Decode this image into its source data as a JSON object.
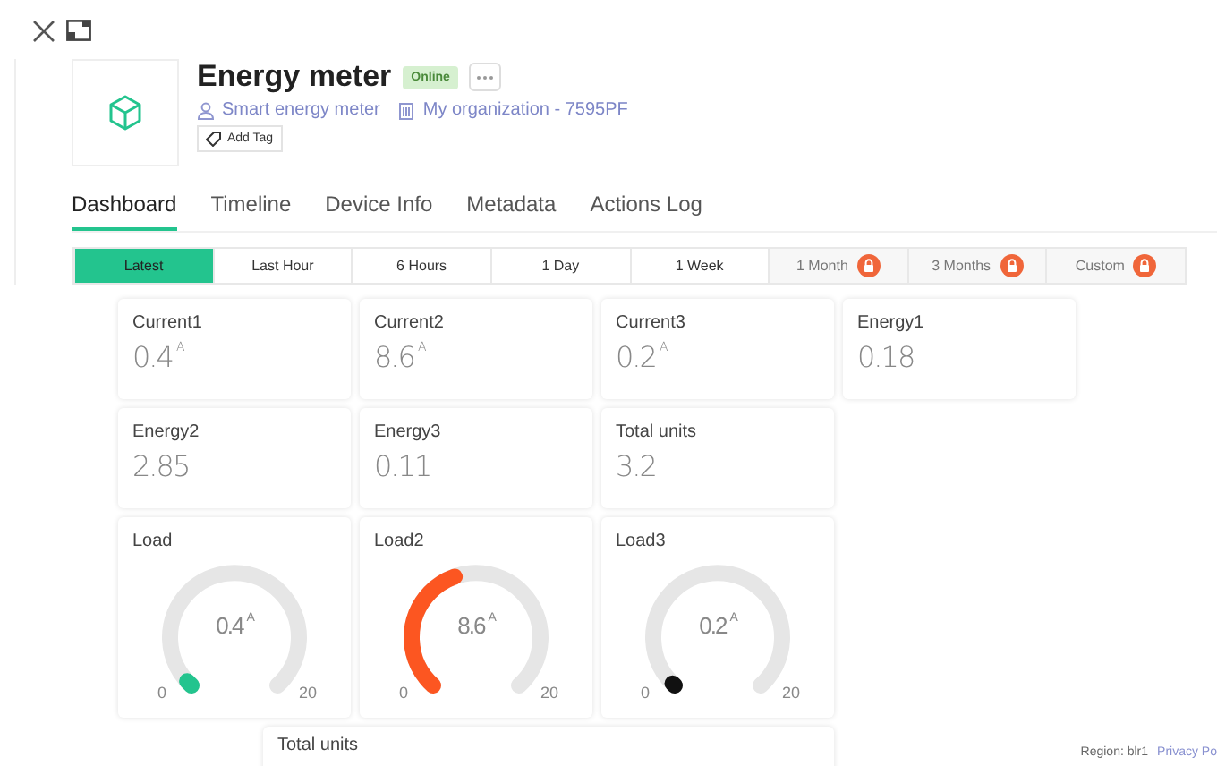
{
  "device": {
    "name": "Energy meter",
    "status": "Online",
    "template": "Smart energy meter",
    "organization": "My organization - 7595PF",
    "add_tag": "Add Tag"
  },
  "tabs": [
    {
      "label": "Dashboard",
      "selected": true
    },
    {
      "label": "Timeline",
      "selected": false
    },
    {
      "label": "Device Info",
      "selected": false
    },
    {
      "label": "Metadata",
      "selected": false
    },
    {
      "label": "Actions Log",
      "selected": false
    }
  ],
  "ranges": [
    {
      "label": "Latest",
      "selected": true,
      "locked": false
    },
    {
      "label": "Last Hour",
      "selected": false,
      "locked": false
    },
    {
      "label": "6 Hours",
      "selected": false,
      "locked": false
    },
    {
      "label": "1 Day",
      "selected": false,
      "locked": false
    },
    {
      "label": "1 Week",
      "selected": false,
      "locked": false
    },
    {
      "label": "1 Month",
      "selected": false,
      "locked": true
    },
    {
      "label": "3 Months",
      "selected": false,
      "locked": true
    },
    {
      "label": "Custom",
      "selected": false,
      "locked": true
    }
  ],
  "widgets": [
    {
      "kind": "value",
      "label": "Current1",
      "value": "0.4",
      "unit": "A"
    },
    {
      "kind": "value",
      "label": "Current2",
      "value": "8.6",
      "unit": "A"
    },
    {
      "kind": "value",
      "label": "Current3",
      "value": "0.2",
      "unit": "A"
    },
    {
      "kind": "value",
      "label": "Energy1",
      "value": "0.18"
    },
    {
      "kind": "value",
      "label": "Energy2",
      "value": "2.85"
    },
    {
      "kind": "value",
      "label": "Energy3",
      "value": "0.11"
    },
    {
      "kind": "value",
      "label": "Total units",
      "value": "3.2"
    },
    {
      "kind": "gauge",
      "label": "Load",
      "value": "0.4",
      "unit": "A",
      "color": "#23c48e",
      "min": "0",
      "max": "20"
    },
    {
      "kind": "gauge",
      "label": "Load2",
      "value": "8.6",
      "unit": "A",
      "color": "#fc5621",
      "min": "0",
      "max": "20"
    },
    {
      "kind": "gauge",
      "label": "Load3",
      "value": "0.2",
      "unit": "A",
      "color": "#111111",
      "min": "0",
      "max": "20"
    },
    {
      "kind": "wide",
      "label": "Total units"
    }
  ],
  "footer": {
    "region": "Region: blr1",
    "link": "Privacy Po"
  }
}
